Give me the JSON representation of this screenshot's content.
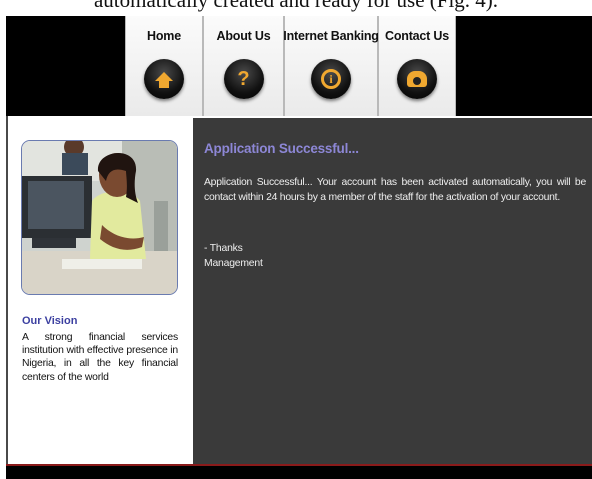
{
  "document_caption": "automatically created and ready for use (Fig. 4).",
  "nav": {
    "items": [
      {
        "label": "Home",
        "icon": "home-icon"
      },
      {
        "label": "About Us",
        "icon": "question-icon"
      },
      {
        "label": "Internet Banking",
        "icon": "info-icon"
      },
      {
        "label": "Contact Us",
        "icon": "phone-icon"
      }
    ]
  },
  "sidebar": {
    "vision_title": "Our Vision",
    "vision_text": "A strong financial services institution with effective presence in Nigeria, in all the key financial centers of the world"
  },
  "main": {
    "title": "Application Successful...",
    "message": "Application Successful... Your account has been activated automatically, you will be contact within 24 hours by a member of the staff for the activation of your account.",
    "thanks_line": "- Thanks",
    "signature": "Management"
  },
  "colors": {
    "accent": "#8d87d6",
    "icon_orange": "#f0a830",
    "content_bg": "#3a3a3a",
    "vision_title": "#3b3fa0"
  }
}
